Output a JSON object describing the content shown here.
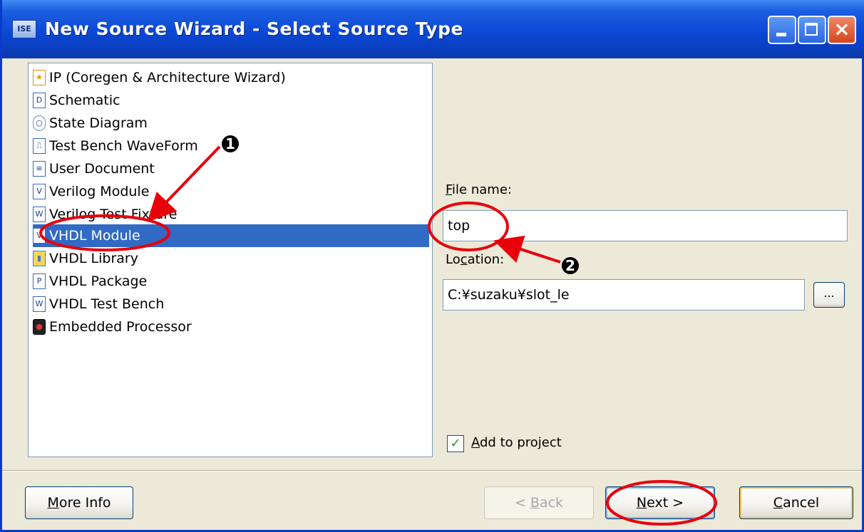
{
  "window": {
    "title": "New Source Wizard - Select Source Type",
    "app_icon_text": "ISE"
  },
  "source_types": [
    {
      "label": "IP (Coregen & Architecture Wizard)",
      "icon": "ip-bulb-icon",
      "glyph": "★"
    },
    {
      "label": "Schematic",
      "icon": "schematic-icon",
      "glyph": "D"
    },
    {
      "label": "State Diagram",
      "icon": "state-diagram-icon",
      "glyph": "○"
    },
    {
      "label": "Test Bench WaveForm",
      "icon": "waveform-icon",
      "glyph": "⎍"
    },
    {
      "label": "User Document",
      "icon": "document-icon",
      "glyph": "≡"
    },
    {
      "label": "Verilog Module",
      "icon": "verilog-module-icon",
      "glyph": "V"
    },
    {
      "label": "Verilog Test Fixture",
      "icon": "verilog-test-fixture-icon",
      "glyph": "W"
    },
    {
      "label": "VHDL Module",
      "icon": "vhdl-module-icon",
      "glyph": "V"
    },
    {
      "label": "VHDL Library",
      "icon": "vhdl-library-icon",
      "glyph": "▮"
    },
    {
      "label": "VHDL Package",
      "icon": "vhdl-package-icon",
      "glyph": "P"
    },
    {
      "label": "VHDL Test Bench",
      "icon": "vhdl-test-bench-icon",
      "glyph": "W"
    },
    {
      "label": "Embedded Processor",
      "icon": "embedded-processor-icon",
      "glyph": "●"
    }
  ],
  "selected_source_type": "VHDL Module",
  "file_name": {
    "label_mnemonic": "F",
    "label_rest": "ile name:",
    "value": "top"
  },
  "location": {
    "label_pre": "Lo",
    "label_mnemonic": "c",
    "label_post": "ation:",
    "value": "C:¥suzaku¥slot_le",
    "browse_label": "..."
  },
  "add_to_project": {
    "label_mnemonic": "A",
    "label_rest": "dd to project",
    "checked": true,
    "check_glyph": "✓"
  },
  "buttons": {
    "more_info": {
      "mnemonic": "M",
      "rest": "ore Info"
    },
    "back": {
      "pre": "< ",
      "mnemonic": "B",
      "rest": "ack"
    },
    "next": {
      "mnemonic": "N",
      "rest": "ext >"
    },
    "cancel": {
      "mnemonic": "C",
      "rest": "ancel"
    }
  },
  "annotations": {
    "marker_1": "1",
    "marker_2": "2",
    "marker_color": "#e8000b"
  },
  "colors": {
    "selection": "#316ac5",
    "titlebar": "#0a48d6",
    "dialog_bg": "#ece9d8"
  }
}
